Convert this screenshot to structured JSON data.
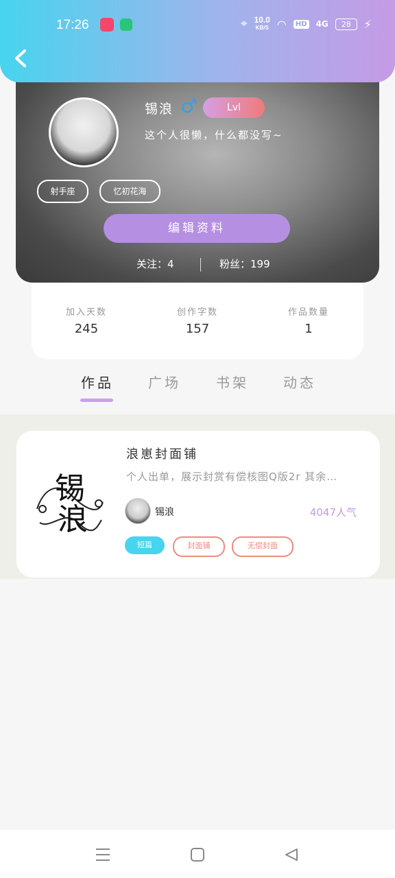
{
  "status_bar": {
    "time": "17:26",
    "net_speed": "10.0",
    "net_unit": "KB/S",
    "hd": "HD",
    "signal": "4G",
    "battery": "28"
  },
  "profile": {
    "username": "锡浪",
    "gender_symbol": "♂",
    "level": "Lvl",
    "bio": "这个人很懒，什么都没写~",
    "tags": [
      "射手座",
      "忆初花海"
    ],
    "edit_label": "编辑资料",
    "following": "关注：4",
    "fans": "粉丝：199"
  },
  "stats": [
    {
      "label": "加入天数",
      "value": "245"
    },
    {
      "label": "创作字数",
      "value": "157"
    },
    {
      "label": "作品数量",
      "value": "1"
    }
  ],
  "tabs": [
    "作品",
    "广场",
    "书架",
    "动态"
  ],
  "work": {
    "title": "浪崽封面铺",
    "description": "个人出单，展示封赏有偿核图Q版2r 其余…",
    "author": "锡浪",
    "popularity": "4047人气",
    "tags": [
      "短篇",
      "封面铺",
      "无偿封面"
    ],
    "cover_text": "锡浪"
  },
  "colors": {
    "accent_cyan": "#47d4ee",
    "accent_purple": "#b590e2",
    "tag_red": "#f08a80"
  }
}
